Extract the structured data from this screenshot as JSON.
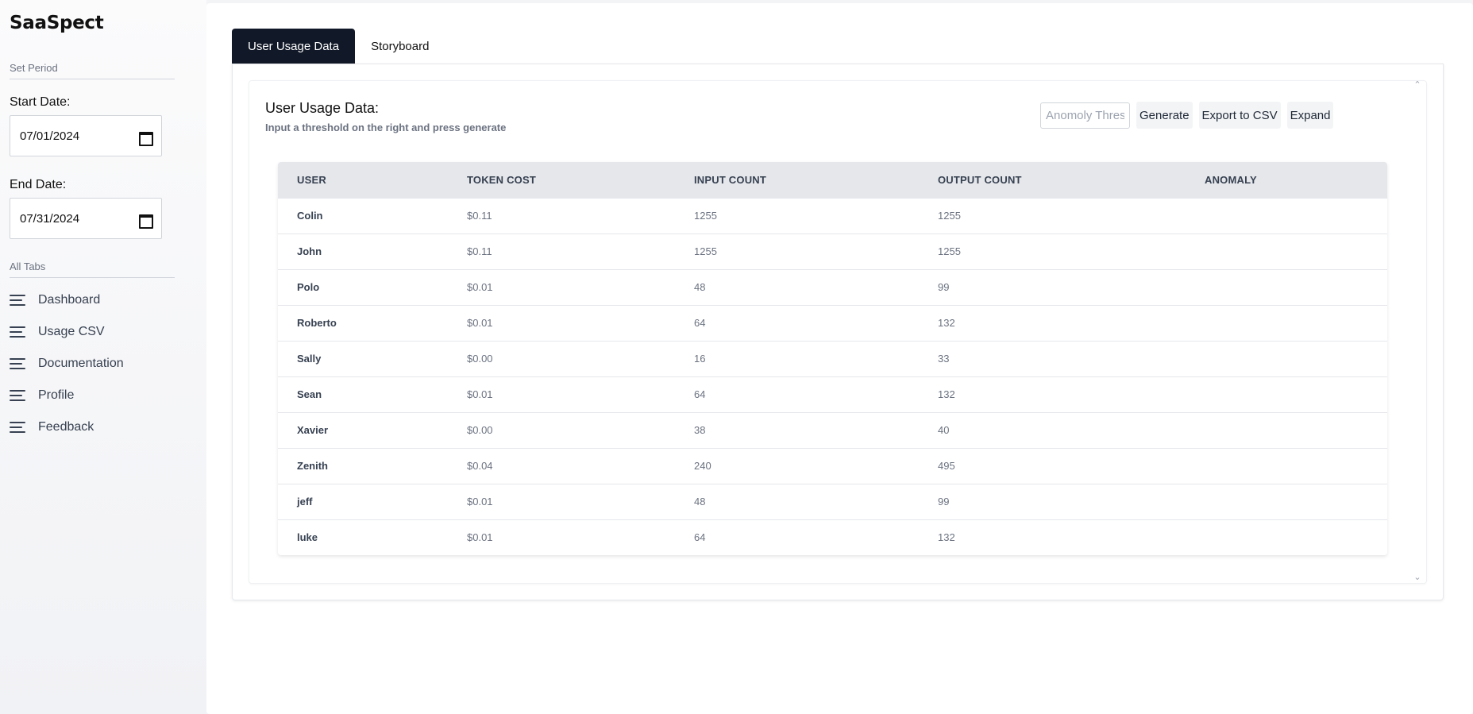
{
  "app": {
    "brand": "SaaSpect"
  },
  "sidebar": {
    "set_period_label": "Set Period",
    "start_date_label": "Start Date:",
    "start_date_value": "07/01/2024",
    "end_date_label": "End Date:",
    "end_date_value": "07/31/2024",
    "all_tabs_label": "All Tabs",
    "items": [
      {
        "label": "Dashboard",
        "icon": "menu-icon"
      },
      {
        "label": "Usage CSV",
        "icon": "menu-icon"
      },
      {
        "label": "Documentation",
        "icon": "menu-icon"
      },
      {
        "label": "Profile",
        "icon": "menu-icon"
      },
      {
        "label": "Feedback",
        "icon": "menu-icon"
      }
    ]
  },
  "tabs": [
    {
      "label": "User Usage Data",
      "active": true
    },
    {
      "label": "Storyboard",
      "active": false
    }
  ],
  "card": {
    "title": "User Usage Data:",
    "subtitle": "Input a threshold on the right and press generate",
    "threshold_placeholder": "Anomoly Threshold",
    "generate_label": "Generate",
    "export_label": "Export to CSV",
    "expand_label": "Expand"
  },
  "table": {
    "columns": [
      "USER",
      "TOKEN COST",
      "INPUT COUNT",
      "OUTPUT COUNT",
      "ANOMALY"
    ],
    "rows": [
      [
        "Colin",
        "$0.11",
        "1255",
        "1255",
        ""
      ],
      [
        "John",
        "$0.11",
        "1255",
        "1255",
        ""
      ],
      [
        "Polo",
        "$0.01",
        "48",
        "99",
        ""
      ],
      [
        "Roberto",
        "$0.01",
        "64",
        "132",
        ""
      ],
      [
        "Sally",
        "$0.00",
        "16",
        "33",
        ""
      ],
      [
        "Sean",
        "$0.01",
        "64",
        "132",
        ""
      ],
      [
        "Xavier",
        "$0.00",
        "38",
        "40",
        ""
      ],
      [
        "Zenith",
        "$0.04",
        "240",
        "495",
        ""
      ],
      [
        "jeff",
        "$0.01",
        "48",
        "99",
        ""
      ],
      [
        "luke",
        "$0.01",
        "64",
        "132",
        ""
      ]
    ]
  },
  "colors": {
    "active_tab": "#111827",
    "table_header": "#e5e7eb"
  }
}
